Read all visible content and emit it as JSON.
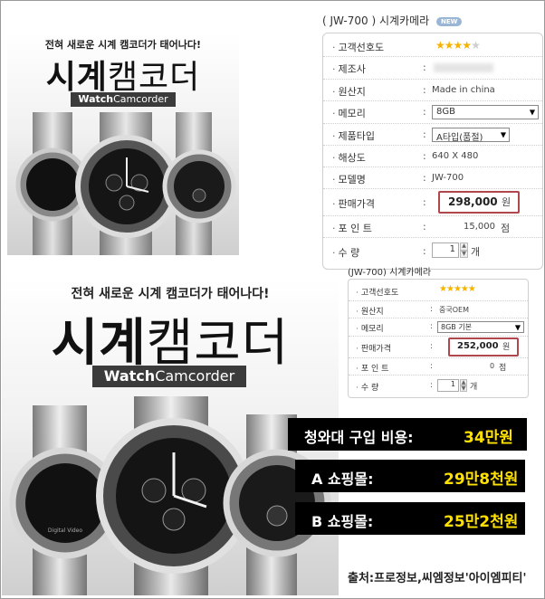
{
  "promo": {
    "tagline": "전혀 새로운 시계 캠코더가 태어나다!",
    "title_bold": "시계",
    "title_light": "캠코더",
    "brand_bold": "Watch",
    "brand_light": "Camcorder",
    "watch_label": "Digital Video"
  },
  "spec_a": {
    "title": "( JW-700 ) 시계카메라",
    "badge": "NEW",
    "rating": 4,
    "rating_max": 5,
    "rows": [
      {
        "label": "고객선호도",
        "type": "stars"
      },
      {
        "label": "제조사",
        "value": "",
        "type": "blur"
      },
      {
        "label": "원산지",
        "value": "Made in china",
        "type": "text"
      },
      {
        "label": "메모리",
        "value": "8GB",
        "type": "select"
      },
      {
        "label": "제품타입",
        "value": "A타입(품절)",
        "type": "select"
      },
      {
        "label": "해상도",
        "value": "640 X 480",
        "type": "text"
      },
      {
        "label": "모델명",
        "value": "JW-700",
        "type": "text"
      },
      {
        "label": "판매가격",
        "value": "298,000",
        "unit": "원",
        "type": "price"
      },
      {
        "label": "포 인 트",
        "value": "15,000",
        "unit": "점",
        "type": "points"
      },
      {
        "label": "수 량",
        "value": "1",
        "unit": "개",
        "type": "qty"
      }
    ]
  },
  "spec_b": {
    "title": "(JW-700) 시계카메라",
    "rating": 5,
    "rating_max": 5,
    "rows": [
      {
        "label": "고객선호도",
        "type": "stars"
      },
      {
        "label": "원산지",
        "value": "중국OEM",
        "type": "text"
      },
      {
        "label": "메모리",
        "value": "8GB 기본",
        "type": "select"
      },
      {
        "label": "판매가격",
        "value": "252,000",
        "unit": "원",
        "type": "price"
      },
      {
        "label": "포 인 트",
        "value": "0",
        "unit": "점",
        "type": "points"
      },
      {
        "label": "수 량",
        "value": "1",
        "unit": "개",
        "type": "qty"
      }
    ]
  },
  "cost": [
    {
      "label": "청와대 구입 비용:",
      "value": "34만원"
    },
    {
      "label": "A 쇼핑몰:",
      "value": "29만8천원"
    },
    {
      "label": "B 쇼핑몰:",
      "value": "25만2천원"
    }
  ],
  "source": "출처:프로정보,씨엠정보'아이엠피티'",
  "colors": {
    "price_border": "#b0474d",
    "badge": "#9ab6d6",
    "highlight": "#ffe100",
    "star": "#f4b400"
  }
}
